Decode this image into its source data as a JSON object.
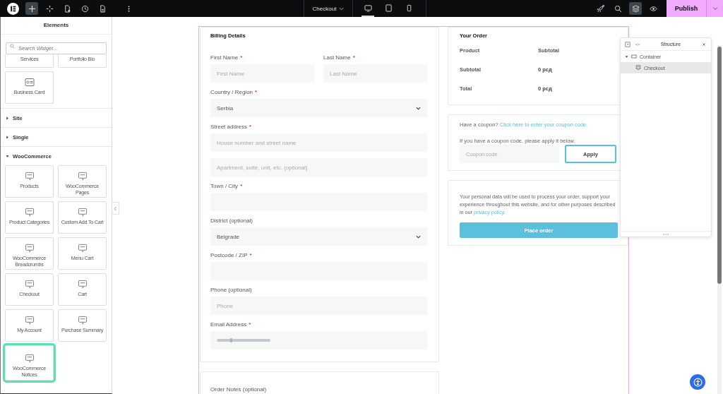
{
  "topbar": {
    "tools": [
      {
        "kind": "add",
        "selected": true
      },
      {
        "kind": "structure",
        "selected": false
      },
      {
        "kind": "page",
        "selected": false
      },
      {
        "kind": "history",
        "selected": false
      },
      {
        "kind": "document",
        "selected": false
      },
      {
        "kind": "more",
        "selected": false
      }
    ],
    "page_title": "Checkout",
    "devices": [
      {
        "kind": "desktop",
        "selected": true
      },
      {
        "kind": "tablet",
        "selected": false
      },
      {
        "kind": "mobile",
        "selected": false
      }
    ],
    "actions": [
      {
        "kind": "notifications",
        "selected": false,
        "badge": true
      },
      {
        "kind": "search",
        "selected": false
      },
      {
        "kind": "layers",
        "selected": true
      },
      {
        "kind": "preview",
        "selected": false
      }
    ],
    "publish": "Publish"
  },
  "sidebar": {
    "title": "Elements",
    "search_placeholder": "Search Widget...",
    "top_widgets": [
      "Services",
      "Portfolio Bio"
    ],
    "widgets_before": [
      {
        "label": "Business Card",
        "highlighted": false
      }
    ],
    "sections": [
      {
        "label": "Site",
        "expanded": false
      },
      {
        "label": "Single",
        "expanded": false
      },
      {
        "label": "WooCommerce",
        "expanded": true,
        "widgets": [
          {
            "label": "Products",
            "highlighted": false
          },
          {
            "label": "WooCommerce Pages",
            "highlighted": false
          },
          {
            "label": "Product Categories",
            "highlighted": false
          },
          {
            "label": "Custom Add To Cart",
            "highlighted": false
          },
          {
            "label": "WooCommerce Breadcrumbs",
            "highlighted": false
          },
          {
            "label": "Menu Cart",
            "highlighted": false
          },
          {
            "label": "Checkout",
            "highlighted": false
          },
          {
            "label": "Cart",
            "highlighted": false
          },
          {
            "label": "My Account",
            "highlighted": false
          },
          {
            "label": "Purchase Summary",
            "highlighted": false
          },
          {
            "label": "WooCommerce Notices",
            "highlighted": true
          }
        ]
      }
    ]
  },
  "billing": {
    "title": "Billing Details",
    "rows": [
      [
        {
          "kind": "text",
          "label": "First Name",
          "mark": "*",
          "placeholder": "First Name"
        },
        {
          "kind": "text",
          "label": "Last Name",
          "mark": "*",
          "placeholder": "Last Name"
        }
      ],
      [
        {
          "kind": "select",
          "label": "Country / Region",
          "mark": "*",
          "value": "Serbia"
        }
      ],
      [
        {
          "kind": "text",
          "label": "Street address",
          "mark": "*",
          "placeholder": "House number and street name"
        }
      ],
      [
        {
          "kind": "text",
          "placeholder": "Apartment, suite, unit, etc. (optional)"
        }
      ],
      [
        {
          "kind": "text",
          "label": "Town / City",
          "mark": "*"
        }
      ],
      [
        {
          "kind": "select",
          "label": "District (optional)",
          "value": "Belgrade"
        }
      ],
      [
        {
          "kind": "text",
          "label": "Postcode / ZIP",
          "mark": "*"
        }
      ],
      [
        {
          "kind": "text",
          "label": "Phone (optional)",
          "placeholder": "Phone"
        }
      ],
      [
        {
          "kind": "blurred",
          "label": "Email Address",
          "mark": "*"
        }
      ]
    ]
  },
  "notes": {
    "label": "Order Notes (optional)"
  },
  "order": {
    "title": "Your Order",
    "columns": [
      "Product",
      "Subtotal"
    ],
    "rows": [
      {
        "label": "Subtotal",
        "value": "0 рсд"
      },
      {
        "label": "Total",
        "value": "0 рсд"
      }
    ]
  },
  "coupon": {
    "prompt": "Have a coupon?",
    "link": "Click here to enter your coupon code",
    "note": "If you have a coupon code, please apply it below.",
    "placeholder": "Coupon code",
    "button": "Apply"
  },
  "privacy": {
    "text": "Your personal data will be used to process your order, support your experience throughout this website, and for other purposes described in our",
    "link": "privacy policy",
    "end": ".",
    "button": "Place order"
  },
  "structure": {
    "title": "Structure",
    "tree": [
      {
        "label": "Container",
        "expanded": true,
        "selected": false,
        "children": [
          {
            "label": "Checkout",
            "selected": true
          }
        ]
      }
    ]
  }
}
